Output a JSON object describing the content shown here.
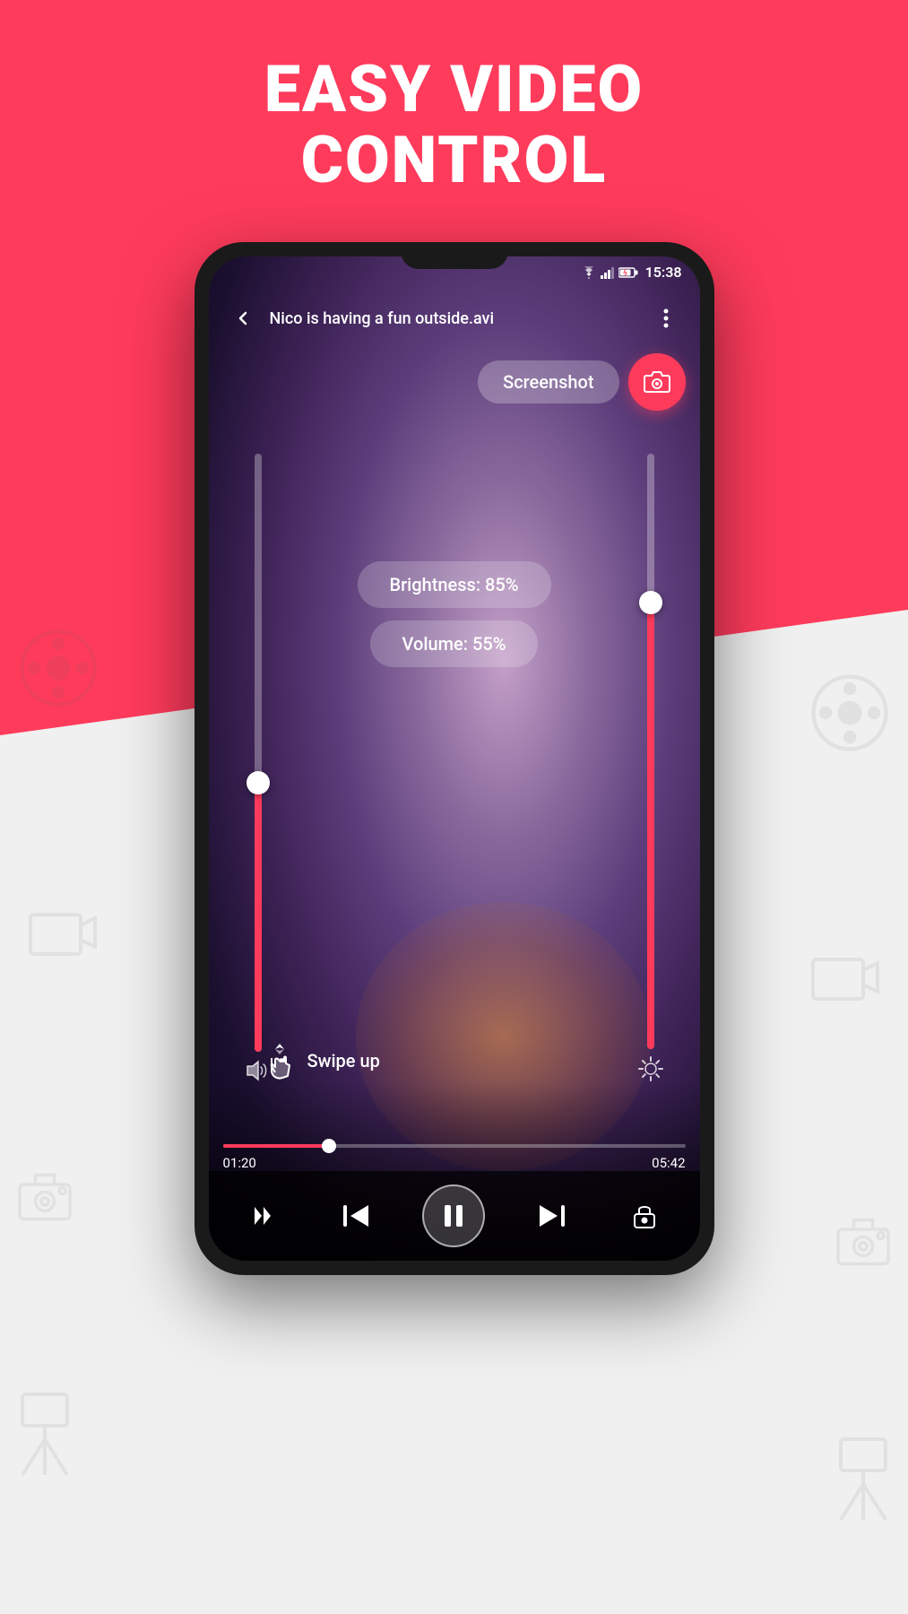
{
  "hero": {
    "line1": "EASY VIDEO",
    "line2": "CONTROL"
  },
  "phone": {
    "status": {
      "time": "15:38"
    },
    "appbar": {
      "title": "Nico is having a fun outside.avi",
      "back_label": "←",
      "more_label": "⋮"
    },
    "screenshot_button": "Screenshot",
    "sliders": {
      "volume_label": "Volume: 55%",
      "brightness_label": "Brightness: 85%"
    },
    "swipe": {
      "text": "Swipe up"
    },
    "progress": {
      "current": "01:20",
      "total": "05:42",
      "percent": 23
    },
    "controls": {
      "prev": "⏮",
      "pause": "⏸",
      "next": "⏭"
    }
  }
}
